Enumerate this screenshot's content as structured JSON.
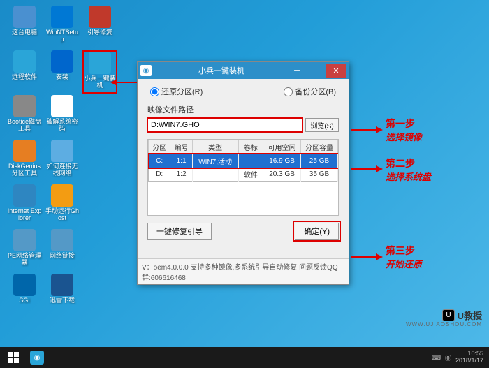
{
  "desktop_icons": [
    {
      "label": "这台电脑",
      "color": "#4a90d0"
    },
    {
      "label": "WinNTSetup",
      "color": "#0078d4"
    },
    {
      "label": "引导修复",
      "color": "#c0392b"
    },
    {
      "label": "远程软件",
      "color": "#2aa5d8"
    },
    {
      "label": "安装",
      "color": "#0066cc"
    },
    {
      "label": "小兵一键装机",
      "color": "#2aa5d8",
      "highlight": true
    },
    {
      "label": "Bootice磁盘工具",
      "color": "#888"
    },
    {
      "label": "破解系统密码",
      "color": "#fff"
    },
    {
      "label": "",
      "color": ""
    },
    {
      "label": "DiskGenius分区工具",
      "color": "#e67e22"
    },
    {
      "label": "如何连接无线网络",
      "color": "#5dade2"
    },
    {
      "label": "",
      "color": ""
    },
    {
      "label": "Internet Explorer",
      "color": "#2e86c1"
    },
    {
      "label": "手动运行Ghost",
      "color": "#f39c12"
    },
    {
      "label": "",
      "color": ""
    },
    {
      "label": "PE网络管理器",
      "color": "#5499c7"
    },
    {
      "label": "网络链接",
      "color": "#5499c7"
    },
    {
      "label": "",
      "color": ""
    },
    {
      "label": "SGI",
      "color": "#0066aa"
    },
    {
      "label": "迅雷下载",
      "color": "#1a5490"
    }
  ],
  "dialog": {
    "title": "小兵一键装机",
    "restore_option": "还原分区(R)",
    "backup_option": "备份分区(B)",
    "path_label": "映像文件路径",
    "path_value": "D:\\WIN7.GHO",
    "browse_btn": "浏览(S)",
    "headers": [
      "分区",
      "编号",
      "类型",
      "卷标",
      "可用空间",
      "分区容量"
    ],
    "rows": [
      {
        "partition": "C:",
        "num": "1:1",
        "type": "WIN7,活动",
        "vol": "",
        "free": "16.9 GB",
        "size": "25 GB",
        "sel": true
      },
      {
        "partition": "D:",
        "num": "1:2",
        "type": "",
        "vol": "软件",
        "free": "20.3 GB",
        "size": "35 GB",
        "sel": false
      }
    ],
    "repair_btn": "一键修复引导",
    "confirm_btn": "确定(Y)",
    "version_text": "V：oem4.0.0.0       支持多种镜像,多系统引导自动修复 问题反馈QQ群:606616468"
  },
  "annotations": {
    "step1": {
      "title": "第一步",
      "desc": "选择镜像"
    },
    "step2": {
      "title": "第二步",
      "desc": "选择系统盘"
    },
    "step3": {
      "title": "第三步",
      "desc": "开始还原"
    }
  },
  "taskbar": {
    "time": "10:55",
    "date": "2018/1/17"
  },
  "watermark": {
    "badge": "U",
    "text": "U教授",
    "sub": "WWW.UJIAOSHOU.COM"
  }
}
